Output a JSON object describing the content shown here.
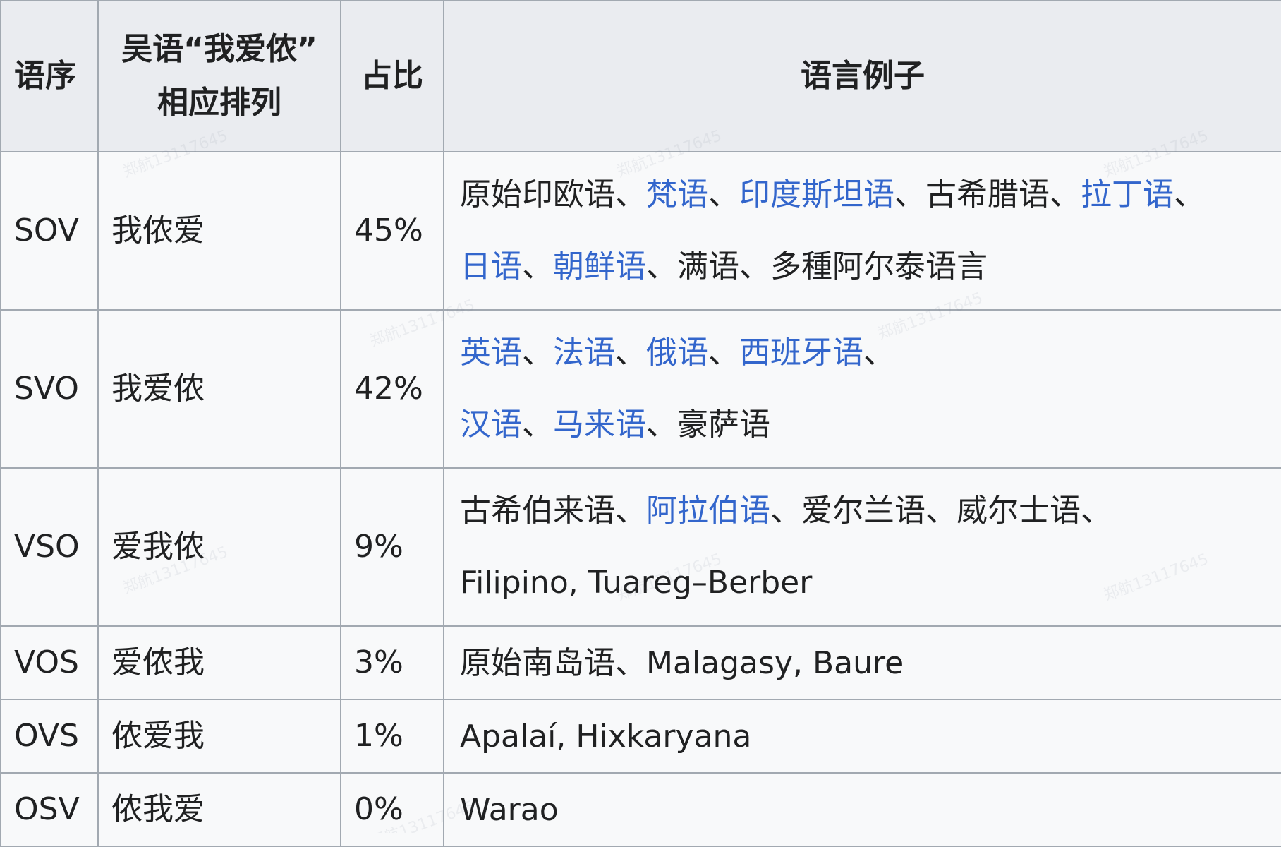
{
  "table": {
    "headers": {
      "order": "语序",
      "wu_line1": "吴语“我爱侬”",
      "wu_line2": "相应排列",
      "share": "占比",
      "examples": "语言例子"
    },
    "rows": [
      {
        "order": "SOV",
        "wu": "我侬爱",
        "share": "45%",
        "examples": [
          [
            {
              "text": "原始印欧语",
              "link": false
            },
            {
              "text": "、",
              "link": false
            },
            {
              "text": "梵语",
              "link": true
            },
            {
              "text": "、",
              "link": false
            },
            {
              "text": "印度斯坦语",
              "link": true
            },
            {
              "text": "、古希腊语、",
              "link": false
            },
            {
              "text": "拉丁语",
              "link": true
            },
            {
              "text": "、",
              "link": false
            }
          ],
          [
            {
              "text": "日语",
              "link": true
            },
            {
              "text": "、",
              "link": false
            },
            {
              "text": "朝鲜语",
              "link": true
            },
            {
              "text": "、满语、多種阿尔泰语言",
              "link": false
            }
          ]
        ]
      },
      {
        "order": "SVO",
        "wu": "我爱侬",
        "share": "42%",
        "examples": [
          [
            {
              "text": "英语",
              "link": true
            },
            {
              "text": "、",
              "link": false
            },
            {
              "text": "法语",
              "link": true
            },
            {
              "text": "、",
              "link": false
            },
            {
              "text": "俄语",
              "link": true
            },
            {
              "text": "、",
              "link": false
            },
            {
              "text": "西班牙语",
              "link": true
            },
            {
              "text": "、",
              "link": false
            }
          ],
          [
            {
              "text": "汉语",
              "link": true
            },
            {
              "text": "、",
              "link": false
            },
            {
              "text": "马来语",
              "link": true
            },
            {
              "text": "、豪萨语",
              "link": false
            }
          ]
        ]
      },
      {
        "order": "VSO",
        "wu": "爱我侬",
        "share": "9%",
        "examples": [
          [
            {
              "text": "古希伯来语、",
              "link": false
            },
            {
              "text": "阿拉伯语",
              "link": true
            },
            {
              "text": "、爱尔兰语、威尔士语、",
              "link": false
            }
          ],
          [
            {
              "text": "Filipino, Tuareg–Berber",
              "link": false
            }
          ]
        ]
      },
      {
        "order": "VOS",
        "wu": "爱侬我",
        "share": "3%",
        "examples": [
          [
            {
              "text": "原始南岛语、Malagasy, Baure",
              "link": false
            }
          ]
        ]
      },
      {
        "order": "OVS",
        "wu": "侬爱我",
        "share": "1%",
        "examples": [
          [
            {
              "text": "Apalaí, Hixkaryana",
              "link": false
            }
          ]
        ]
      },
      {
        "order": "OSV",
        "wu": "侬我爱",
        "share": "0%",
        "examples": [
          [
            {
              "text": "Warao",
              "link": false
            }
          ]
        ]
      }
    ]
  },
  "watermark": "郑航13117645",
  "colors": {
    "link": "#3366cc",
    "text": "#202122",
    "header_bg": "#eaecf0",
    "cell_bg": "#f8f9fa",
    "border": "#a2a9b1"
  }
}
